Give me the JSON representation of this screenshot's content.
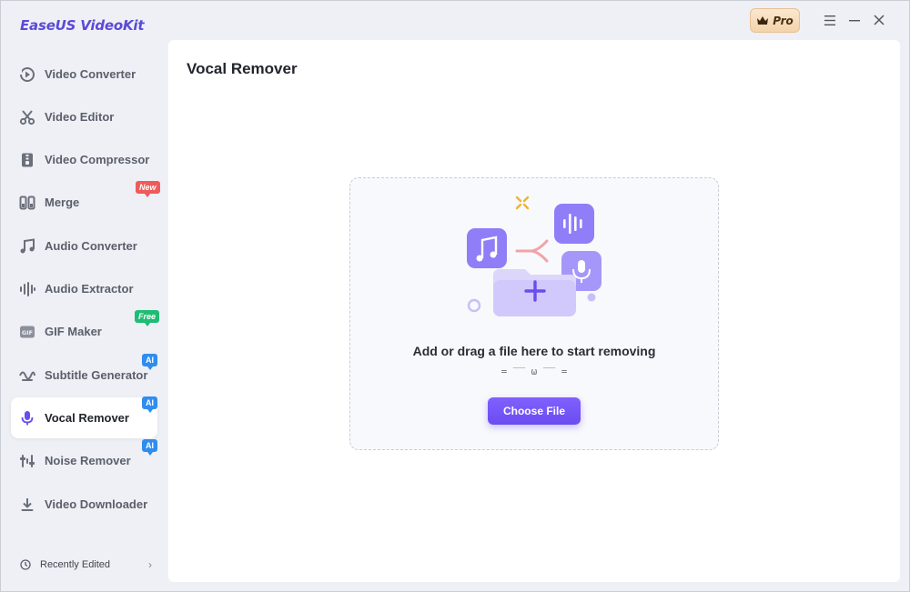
{
  "app": {
    "title": "EaseUS VideoKit",
    "pro_label": "Pro"
  },
  "sidebar": {
    "items": [
      {
        "label": "Video Converter",
        "icon": "video-converter-icon"
      },
      {
        "label": "Video Editor",
        "icon": "scissors-icon"
      },
      {
        "label": "Video Compressor",
        "icon": "compress-icon"
      },
      {
        "label": "Merge",
        "icon": "merge-icon",
        "tag": "New"
      },
      {
        "label": "Audio Converter",
        "icon": "music-note-icon"
      },
      {
        "label": "Audio Extractor",
        "icon": "waveform-icon"
      },
      {
        "label": "GIF Maker",
        "icon": "gif-icon",
        "tag": "Free"
      },
      {
        "label": "Subtitle Generator",
        "icon": "subtitle-icon",
        "tag": "AI"
      },
      {
        "label": "Vocal Remover",
        "icon": "microphone-icon",
        "tag": "AI",
        "active": true
      },
      {
        "label": "Noise Remover",
        "icon": "noise-icon",
        "tag": "AI"
      },
      {
        "label": "Video Downloader",
        "icon": "download-icon"
      }
    ],
    "recent_label": "Recently Edited"
  },
  "main": {
    "title": "Vocal Remover",
    "drop_text": "Add or drag a file here to start removing",
    "drop_face": "= ‾‾ ω ‾‾ =",
    "button_label": "Choose File"
  },
  "colors": {
    "accent": "#6a4cf0",
    "sidebar_bg": "#eef0f6",
    "tag_new": "#ee5b5b",
    "tag_free": "#1ebd73",
    "tag_ai": "#2f8df0"
  }
}
